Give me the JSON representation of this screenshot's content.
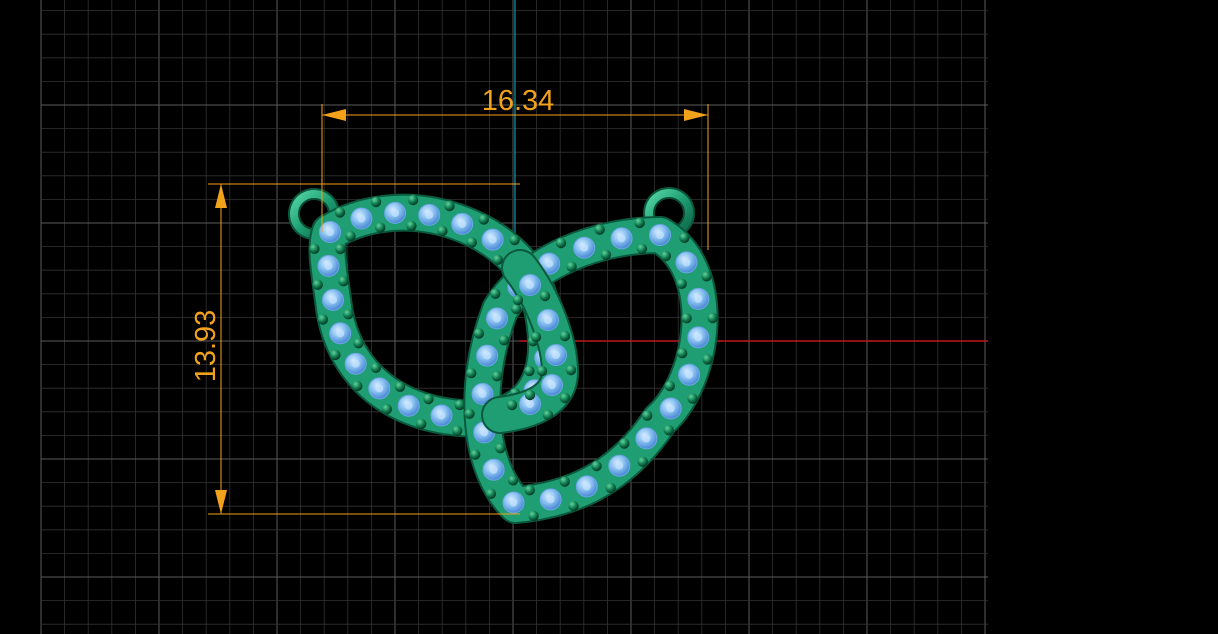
{
  "dimensions": {
    "width_label": "16.34",
    "height_label": "13.93"
  },
  "colors": {
    "background": "#000000",
    "grid_minor": "#333333",
    "grid_major": "#5a5a5a",
    "axis_x": "#c01818",
    "axis_y": "#0f9aa8",
    "dimension": "#f2a21a",
    "metal": "#1e9e72",
    "metal_dark": "#0b5a3e",
    "stone": "#8cc3f2",
    "stone_dark": "#3f7fd0",
    "prong": "#0e6a44"
  },
  "icons": {
    "bail_left": "jump-ring-icon",
    "bail_right": "jump-ring-icon"
  }
}
